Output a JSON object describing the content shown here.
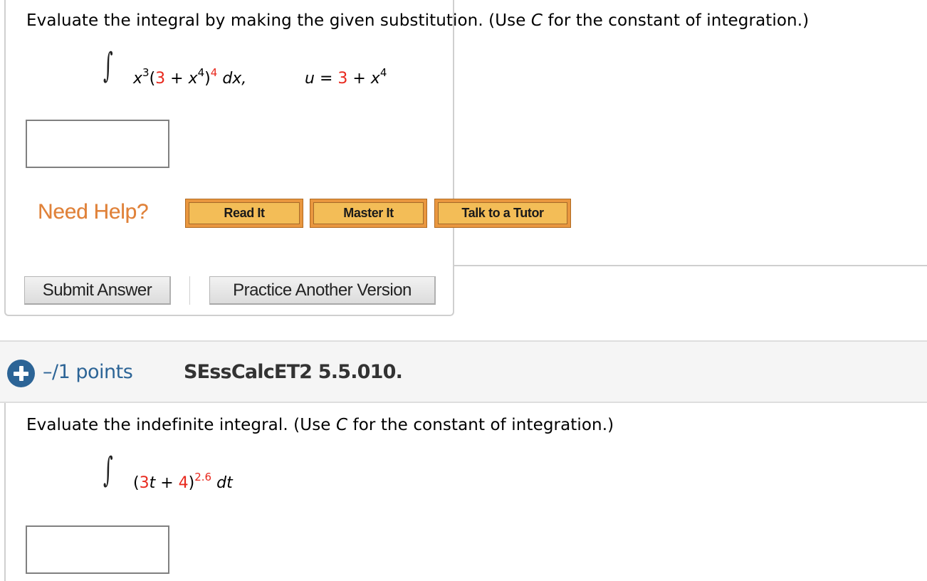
{
  "question1": {
    "prompt_before": "Evaluate the integral by making the given substitution. (Use ",
    "prompt_var": "C",
    "prompt_after": " for the constant of integration.)",
    "integrand": {
      "base_var": "x",
      "base_exp": "3",
      "open_paren": "(",
      "const": "3",
      "plus": " + ",
      "inner_var": "x",
      "inner_exp": "4",
      "close_paren": ")",
      "outer_exp": "4",
      "differential": "dx,"
    },
    "substitution": {
      "var": "u",
      "equals": " = ",
      "const": "3",
      "plus": " + ",
      "term_var": "x",
      "term_exp": "4"
    },
    "answer_value": ""
  },
  "help": {
    "label": "Need Help?",
    "buttons": [
      "Read It",
      "Master It",
      "Talk to a Tutor"
    ]
  },
  "actions": {
    "submit_label": "Submit Answer",
    "practice_label": "Practice Another Version"
  },
  "question2_header": {
    "points": "–/1 points",
    "id": "SEssCalcET2 5.5.010."
  },
  "question2": {
    "prompt_before": "Evaluate the indefinite integral. (Use ",
    "prompt_var": "C",
    "prompt_after": " for the constant of integration.)",
    "integrand": {
      "open_paren": "(",
      "coef": "3",
      "var": "t",
      "plus": " + ",
      "const": "4",
      "close_paren": ")",
      "exp": "2.6",
      "differential": "dt"
    },
    "answer_value": ""
  },
  "colors": {
    "highlight_red": "#e8281d",
    "help_orange": "#e0823a",
    "points_blue": "#2c6496"
  }
}
